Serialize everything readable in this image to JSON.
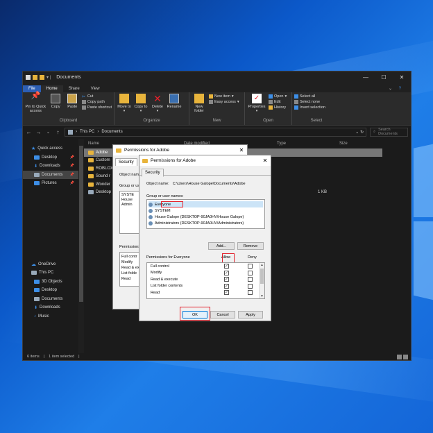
{
  "window": {
    "title": "Documents",
    "controls": [
      "—",
      "☐",
      "✕"
    ]
  },
  "ribbon_tabs": [
    "File",
    "Home",
    "Share",
    "View"
  ],
  "ribbon": {
    "clipboard": {
      "name": "Clipboard",
      "pin": "Pin to Quick access",
      "copy": "Copy",
      "paste": "Paste",
      "cut": "Cut",
      "copy_path": "Copy path",
      "paste_shortcut": "Paste shortcut"
    },
    "organize": {
      "name": "Organize",
      "move_to": "Move to",
      "copy_to": "Copy to",
      "delete": "Delete",
      "rename": "Rename"
    },
    "new": {
      "name": "New",
      "new_folder": "New folder",
      "new_item": "New item",
      "easy_access": "Easy access"
    },
    "open": {
      "name": "Open",
      "properties": "Properties",
      "open": "Open",
      "edit": "Edit",
      "history": "History"
    },
    "select": {
      "name": "Select",
      "select_all": "Select all",
      "select_none": "Select none",
      "invert": "Invert selection"
    }
  },
  "address": {
    "path": [
      "This PC",
      "Documents"
    ],
    "search_placeholder": "Search Documents"
  },
  "nav_pane": [
    {
      "label": "Quick access",
      "icon": "star",
      "level": 0
    },
    {
      "label": "Desktop",
      "icon": "folder-blue",
      "level": 1,
      "pinned": true
    },
    {
      "label": "Downloads",
      "icon": "download",
      "level": 1,
      "pinned": true
    },
    {
      "label": "Documents",
      "icon": "folder-gray",
      "level": 1,
      "pinned": true,
      "selected": true
    },
    {
      "label": "Pictures",
      "icon": "folder-blue",
      "level": 1,
      "pinned": true
    },
    {
      "label": "OneDrive",
      "icon": "cloud",
      "level": 0,
      "gap": true
    },
    {
      "label": "This PC",
      "icon": "pc",
      "level": 0
    },
    {
      "label": "3D Objects",
      "icon": "folder-blue",
      "level": 1
    },
    {
      "label": "Desktop",
      "icon": "folder-blue",
      "level": 1
    },
    {
      "label": "Documents",
      "icon": "folder-gray",
      "level": 1
    },
    {
      "label": "Downloads",
      "icon": "download",
      "level": 1
    },
    {
      "label": "Music",
      "icon": "music",
      "level": 1
    }
  ],
  "file_columns": [
    "Name",
    "Date modified",
    "Type",
    "Size"
  ],
  "files": [
    {
      "name": "Adobe",
      "size": ""
    },
    {
      "name": "Custom",
      "size": ""
    },
    {
      "name": "ROBLOX",
      "size": ""
    },
    {
      "name": "Sound r",
      "size": ""
    },
    {
      "name": "Wonder",
      "size": ""
    },
    {
      "name": "Desktop",
      "size": "1 KB"
    }
  ],
  "status": {
    "items": "6 items",
    "selected": "1 item selected"
  },
  "back_dialog": {
    "title": "Permissions for Adobe",
    "tab": "Security",
    "object_label": "Object name",
    "group_label": "Group or user",
    "users": [
      "SYSTE",
      "House",
      "Admin"
    ],
    "perm_label": "Permissions",
    "perms": [
      "Full contr",
      "Modify",
      "Read & ex",
      "List folde",
      "Read"
    ]
  },
  "dialog": {
    "title": "Permissions for Adobe",
    "tab": "Security",
    "object_label": "Object name:",
    "object_value": "C:\\Users\\House Galope\\Documents\\Adobe",
    "group_label": "Group or user names:",
    "users": [
      "Everyone",
      "SYSTEM",
      "House Galope (DESKTOP-90JA0HV\\House Galope)",
      "Administrators (DESKTOP-90JA0HV\\Administrators)"
    ],
    "add": "Add...",
    "remove": "Remove",
    "perm_label": "Permissions for Everyone",
    "allow_label": "Allow",
    "deny_label": "Deny",
    "permissions": [
      {
        "name": "Full control",
        "allow": true,
        "deny": false
      },
      {
        "name": "Modify",
        "allow": true,
        "deny": false
      },
      {
        "name": "Read & execute",
        "allow": true,
        "deny": false
      },
      {
        "name": "List folder contents",
        "allow": true,
        "deny": false
      },
      {
        "name": "Read",
        "allow": true,
        "deny": false
      }
    ],
    "ok": "OK",
    "cancel": "Cancel",
    "apply": "Apply"
  },
  "colors": {
    "highlight": "#e2202a",
    "accent": "#2d5fb5",
    "folder": "#e8b43c"
  }
}
